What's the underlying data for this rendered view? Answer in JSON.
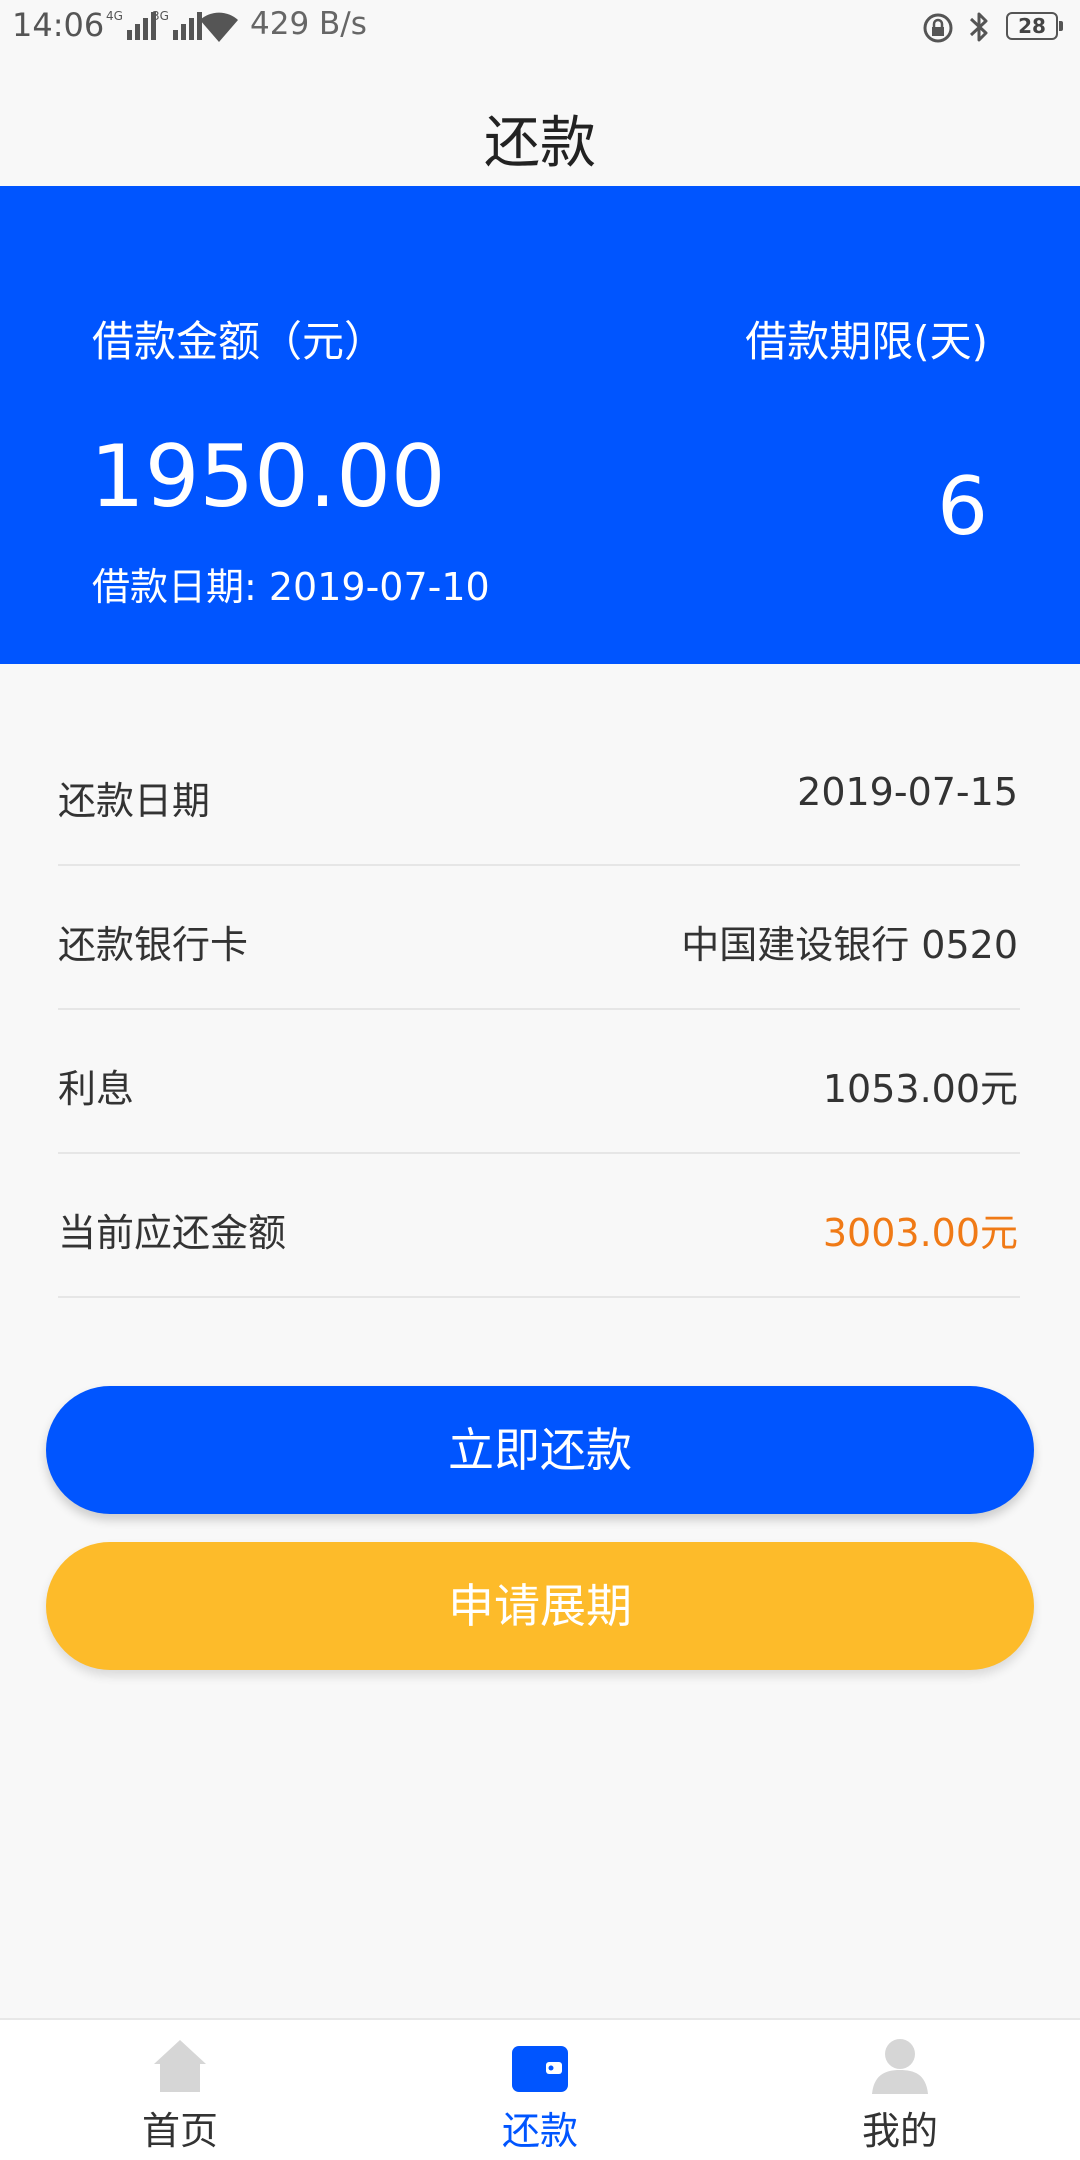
{
  "status_bar": {
    "time": "14:06",
    "signal1_tag": "4G",
    "signal2_tag": "3G",
    "net_speed": "429 B/s",
    "battery": "28"
  },
  "header": {
    "title": "还款"
  },
  "loan_card": {
    "amount_label": "借款金额（元）",
    "amount_value": "1950.00",
    "date_text": "借款日期: 2019-07-10",
    "term_label": "借款期限(天)",
    "term_value": "6"
  },
  "details": [
    {
      "label": "还款日期",
      "value": "2019-07-15"
    },
    {
      "label": "还款银行卡",
      "value": "中国建设银行  0520"
    },
    {
      "label": "利息",
      "value": "1053.00元"
    },
    {
      "label": "当前应还金额",
      "value": "3003.00元"
    }
  ],
  "buttons": {
    "repay_label": "立即还款",
    "extend_label": "申请展期"
  },
  "nav": {
    "items": [
      {
        "label": "首页",
        "icon": "home-icon"
      },
      {
        "label": "还款",
        "icon": "wallet-icon"
      },
      {
        "label": "我的",
        "icon": "user-icon"
      }
    ]
  },
  "colors": {
    "primary": "#0055ff",
    "accent_orange": "#f07a16",
    "button_yellow": "#fdbb2a",
    "inactive_icon": "#d6d6d6"
  }
}
